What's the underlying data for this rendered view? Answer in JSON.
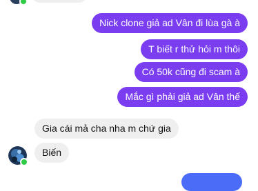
{
  "conversation": {
    "messages": [
      {
        "from": "me",
        "text": "Nick clone giả ad Vân đi lùa gà à"
      },
      {
        "from": "me",
        "text": "T biết r thử hỏi m thôi"
      },
      {
        "from": "me",
        "text": "Có 50k cũng đi scam à"
      },
      {
        "from": "me",
        "text": "Mắc gì phải giả ad Vân thế"
      },
      {
        "from": "them",
        "text": "Gia cái mả cha nha m chứ gia"
      },
      {
        "from": "them",
        "text": "Biến"
      }
    ]
  },
  "colors": {
    "sent_bubble": "#7a3df0",
    "received_bubble": "#efefef",
    "online_dot": "#31cc46"
  },
  "icons": [
    "contact-avatar",
    "online-status-dot"
  ]
}
